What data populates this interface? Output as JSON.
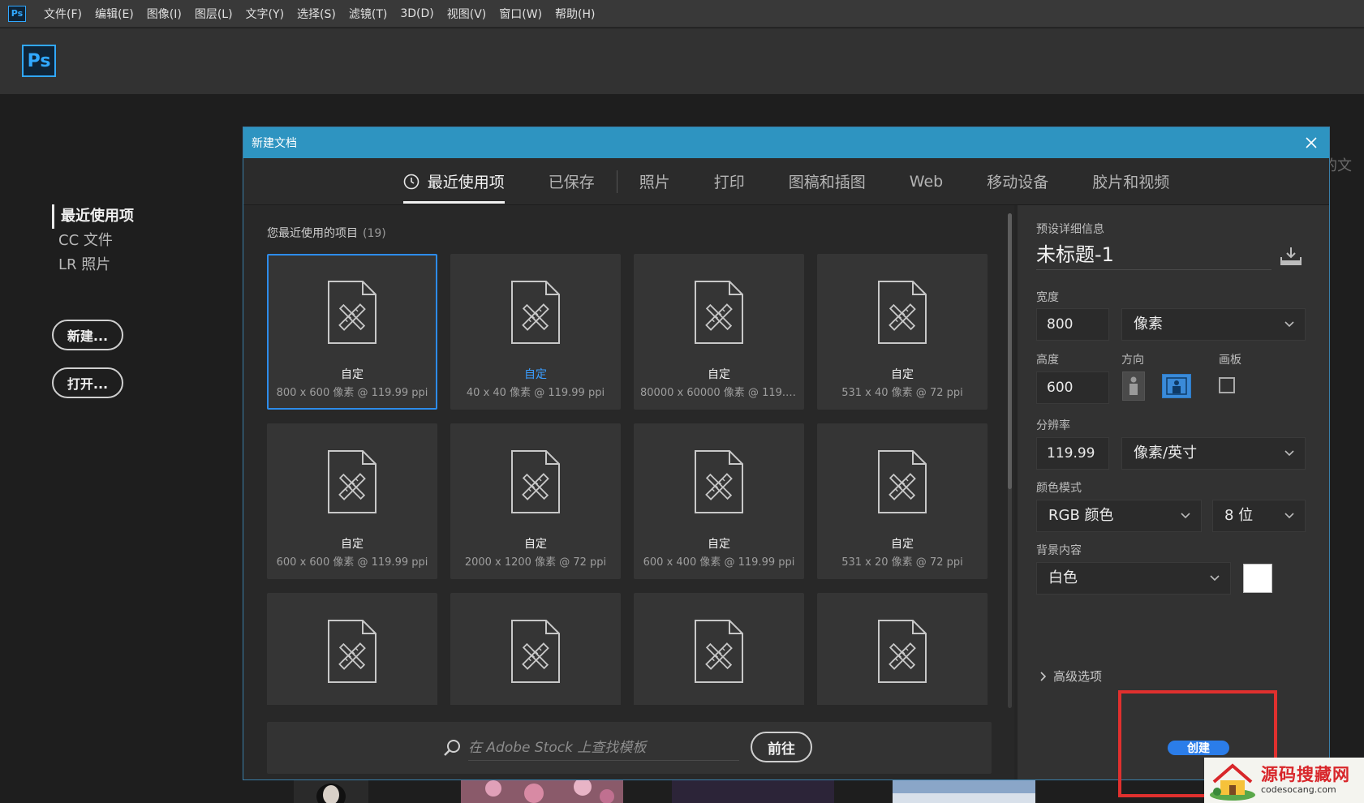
{
  "menubar": {
    "logo": "Ps",
    "items": [
      "文件(F)",
      "编辑(E)",
      "图像(I)",
      "图层(L)",
      "文字(Y)",
      "选择(S)",
      "滤镜(T)",
      "3D(D)",
      "视图(V)",
      "窗口(W)",
      "帮助(H)"
    ]
  },
  "home": {
    "logo": "Ps",
    "nav": [
      "最近使用项",
      "CC 文件",
      "LR 照片"
    ],
    "new_button": "新建...",
    "open_button": "打开...",
    "background_text": "的文"
  },
  "dialog": {
    "title": "新建文档",
    "close_icon": "close-icon",
    "tabs": [
      {
        "label": "最近使用项",
        "active": true,
        "icon": "clock-icon"
      },
      {
        "label": "已保存",
        "active": false
      },
      {
        "label": "照片",
        "active": false
      },
      {
        "label": "打印",
        "active": false
      },
      {
        "label": "图稿和插图",
        "active": false
      },
      {
        "label": "Web",
        "active": false
      },
      {
        "label": "移动设备",
        "active": false
      },
      {
        "label": "胶片和视频",
        "active": false
      }
    ],
    "recent": {
      "heading": "您最近使用的项目",
      "count": "(19)",
      "items": [
        {
          "name": "自定",
          "dims": "800 x 600 像素 @ 119.99 ppi",
          "selected": true,
          "highlighted": false
        },
        {
          "name": "自定",
          "dims": "40 x 40 像素 @ 119.99 ppi",
          "selected": false,
          "highlighted": true
        },
        {
          "name": "自定",
          "dims": "80000 x 60000 像素 @ 119.9...",
          "selected": false,
          "highlighted": false
        },
        {
          "name": "自定",
          "dims": "531 x 40 像素 @ 72 ppi",
          "selected": false,
          "highlighted": false
        },
        {
          "name": "自定",
          "dims": "600 x 600 像素 @ 119.99 ppi",
          "selected": false,
          "highlighted": false
        },
        {
          "name": "自定",
          "dims": "2000 x 1200 像素 @ 72 ppi",
          "selected": false,
          "highlighted": false
        },
        {
          "name": "自定",
          "dims": "600 x 400 像素 @ 119.99 ppi",
          "selected": false,
          "highlighted": false
        },
        {
          "name": "自定",
          "dims": "531 x 20 像素 @ 72 ppi",
          "selected": false,
          "highlighted": false
        },
        {
          "name": "",
          "dims": "",
          "selected": false,
          "highlighted": false
        },
        {
          "name": "",
          "dims": "",
          "selected": false,
          "highlighted": false
        },
        {
          "name": "",
          "dims": "",
          "selected": false,
          "highlighted": false
        },
        {
          "name": "",
          "dims": "",
          "selected": false,
          "highlighted": false
        }
      ]
    },
    "stock": {
      "placeholder": "在 Adobe Stock 上查找模板",
      "go_button": "前往"
    },
    "preset": {
      "heading": "预设详细信息",
      "doc_name": "未标题-1",
      "width_label": "宽度",
      "width_value": "800",
      "width_unit": "像素",
      "height_label": "高度",
      "height_value": "600",
      "orientation_label": "方向",
      "artboard_label": "画板",
      "resolution_label": "分辨率",
      "resolution_value": "119.99",
      "resolution_unit": "像素/英寸",
      "color_mode_label": "颜色模式",
      "color_mode": "RGB 颜色",
      "bit_depth": "8 位",
      "background_label": "背景内容",
      "background": "白色",
      "background_color": "#ffffff",
      "advanced": "高级选项",
      "create_button": "创建"
    }
  },
  "watermark": {
    "title": "源码搜藏网",
    "url": "codesocang.com"
  },
  "colors": {
    "accent": "#2e94c1",
    "selection": "#2d8ceb",
    "highlight_box": "#e0302e"
  }
}
